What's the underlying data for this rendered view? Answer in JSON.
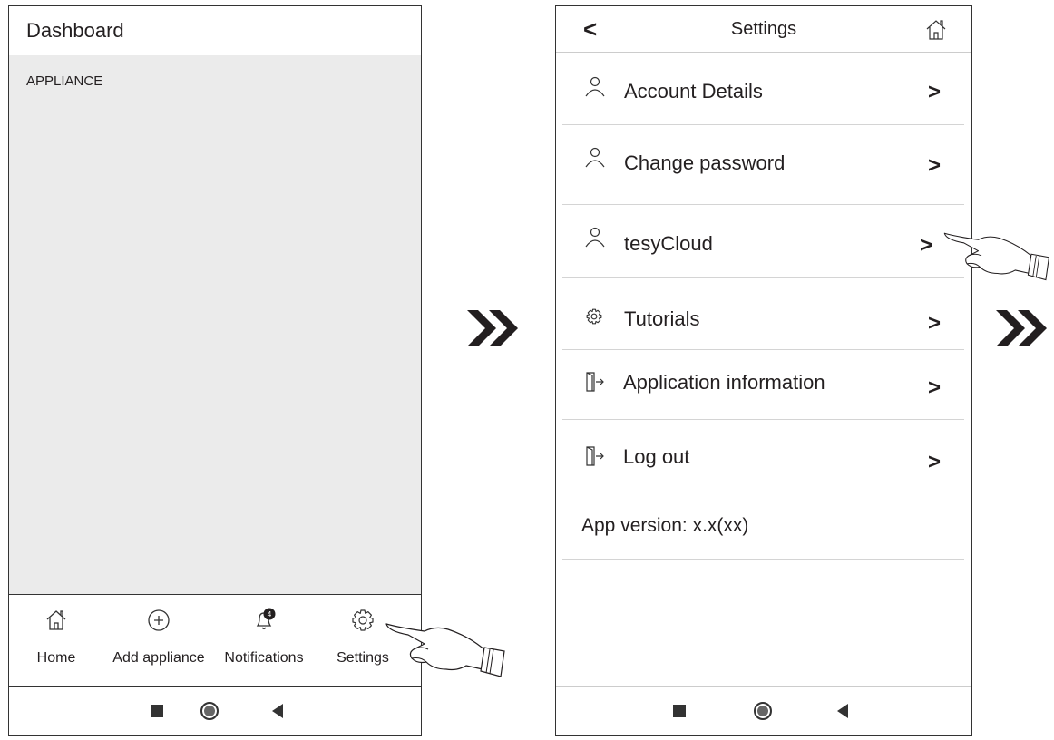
{
  "left_screen": {
    "title": "Dashboard",
    "section_label": "APPLIANCE",
    "tabs": [
      {
        "label": "Home",
        "icon": "home-icon"
      },
      {
        "label": "Add appliance",
        "icon": "plus-circle-icon"
      },
      {
        "label": "Notifications",
        "icon": "bell-icon",
        "badge": "4"
      },
      {
        "label": "Settings",
        "icon": "gear-icon"
      }
    ]
  },
  "right_screen": {
    "title": "Settings",
    "back_icon": "chevron-left-icon",
    "home_icon": "home-icon",
    "items": [
      {
        "label": "Account Details",
        "icon": "user-icon"
      },
      {
        "label": "Change password",
        "icon": "user-icon"
      },
      {
        "label": "tesyCloud",
        "icon": "user-icon"
      },
      {
        "label": "Tutorials",
        "icon": "gear-icon"
      },
      {
        "label": "Application information",
        "icon": "exit-door-icon"
      },
      {
        "label": "Log out",
        "icon": "exit-door-icon"
      }
    ],
    "version": "App version: x.x(xx)"
  },
  "chevron": ">",
  "back_symbol": "<",
  "colors": {
    "content_bg": "#ebebeb",
    "border": "#333333",
    "text": "#231f20"
  }
}
